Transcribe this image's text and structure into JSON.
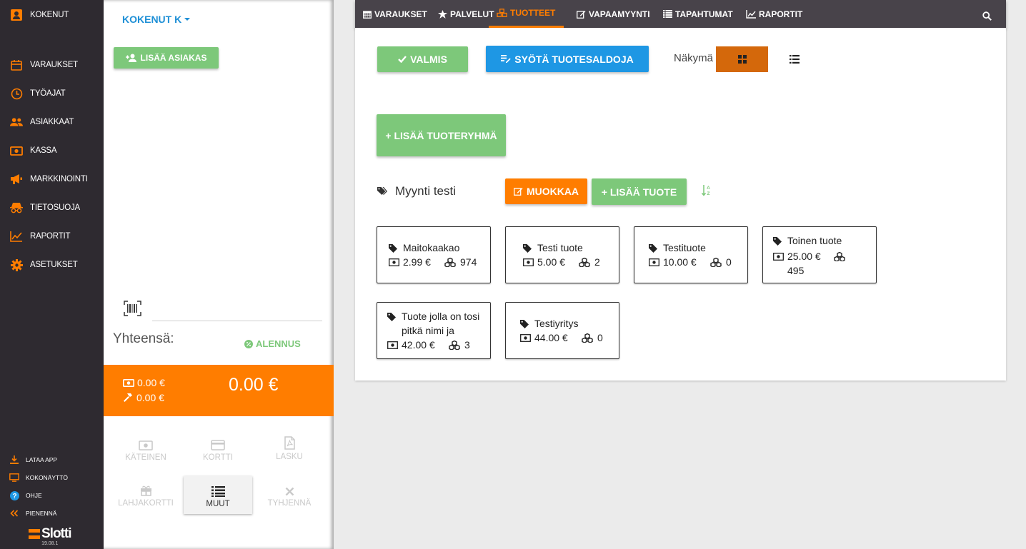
{
  "nav": {
    "user_label": "KOKENUT",
    "items": [
      {
        "label": "VARAUKSET",
        "icon": "calendar-icon"
      },
      {
        "label": "TYÖAJAT",
        "icon": "clock-icon"
      },
      {
        "label": "ASIAKKAAT",
        "icon": "users-icon"
      },
      {
        "label": "KASSA",
        "icon": "money-icon"
      },
      {
        "label": "MARKKINOINTI",
        "icon": "megaphone-icon"
      },
      {
        "label": "TIETOSUOJA",
        "icon": "incognito-icon"
      },
      {
        "label": "RAPORTIT",
        "icon": "line-chart-icon"
      },
      {
        "label": "ASETUKSET",
        "icon": "gear-icon"
      }
    ],
    "bottom": [
      {
        "label": "LATAA APP",
        "icon": "download-icon"
      },
      {
        "label": "KOKONÄYTTÖ",
        "icon": "monitor-icon"
      },
      {
        "label": "OHJE",
        "icon": "help-icon"
      },
      {
        "label": "PIENENNÄ",
        "icon": "double-chevron-left-icon"
      }
    ],
    "brand": "Slotti",
    "version": "19.08.1",
    "accent": "#ff7d00"
  },
  "cart": {
    "user": "KOKENUT K",
    "add_customer": "LISÄÄ ASIAKAS",
    "total_label": "Yhteensä:",
    "discount": "ALENNUS",
    "cash_amount": "0.00 €",
    "hammer_amount": "0.00 €",
    "total": "0.00 €",
    "payments": [
      {
        "label": "KÄTEINEN",
        "icon": "money-icon"
      },
      {
        "label": "KORTTI",
        "icon": "credit-card-icon"
      },
      {
        "label": "LASKU",
        "icon": "pdf-icon"
      },
      {
        "label": "LAHJAKORTTI",
        "icon": "gift-icon"
      },
      {
        "label": "MUUT",
        "icon": "list-icon"
      },
      {
        "label": "TYHJENNÄ",
        "icon": "close-icon"
      }
    ]
  },
  "topbar": {
    "tabs": [
      {
        "label": "VARAUKSET",
        "icon": "calendar-icon"
      },
      {
        "label": "PALVELUT",
        "icon": "star-icon"
      },
      {
        "label": "TUOTTEET",
        "icon": "cubes-icon",
        "active": true
      },
      {
        "label": "VAPAAMYYNTI",
        "icon": "edit-icon"
      },
      {
        "label": "TAPAHTUMAT",
        "icon": "list-icon"
      },
      {
        "label": "RAPORTIT",
        "icon": "line-chart-icon"
      }
    ]
  },
  "main": {
    "done": "VALMIS",
    "enter_stock": "SYÖTÄ TUOTESALDOJA",
    "view_label": "Näkymä",
    "add_group": "+ LISÄÄ TUOTERYHMÄ",
    "group": {
      "name": "Myynti testi",
      "edit": "MUOKKAA",
      "add_product": "+ LISÄÄ TUOTE"
    },
    "products": [
      {
        "name": "Maitokaakao",
        "price": "2.99 €",
        "stock": "974"
      },
      {
        "name": "Testi tuote",
        "price": "5.00 €",
        "stock": "2"
      },
      {
        "name": "Testituote",
        "price": "10.00 €",
        "stock": "0"
      },
      {
        "name": "Toinen tuote",
        "price": "25.00 €",
        "stock": "495"
      },
      {
        "name": "Tuote jolla on tosi pitkä nimi ja",
        "price": "42.00 €",
        "stock": "3"
      },
      {
        "name": "Testiyritys",
        "price": "44.00 €",
        "stock": "0"
      }
    ]
  }
}
